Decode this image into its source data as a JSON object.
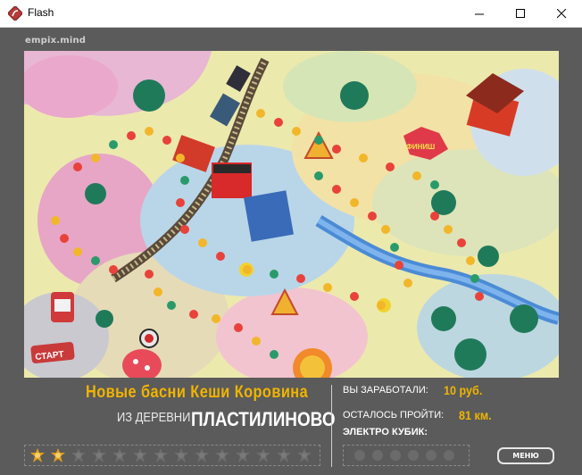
{
  "window": {
    "title": "Flash"
  },
  "brand": "empix.mind",
  "board": {
    "start_label": "СТАРТ",
    "sign_label": "ФИНИШ"
  },
  "headline": {
    "line1": "Новые басни Кеши Коровина",
    "line2_small": "ИЗ ДЕРЕВНИ",
    "line2_big": "ПЛАСТИЛИНОВО"
  },
  "stats": {
    "earned_label": "ВЫ ЗАРАБОТАЛИ:",
    "earned_value": "10 руб.",
    "remaining_label": "ОСТАЛОСЬ ПРОЙТИ:",
    "remaining_value": "81 км.",
    "dice_label": "ЭЛЕКТРО КУБИК:"
  },
  "stars": {
    "total": 14,
    "earned": 2
  },
  "dice": {
    "count": 6
  },
  "menu_label": "МЕНЮ",
  "colors": {
    "accent": "#f0b400",
    "background": "#5b5b5b"
  }
}
